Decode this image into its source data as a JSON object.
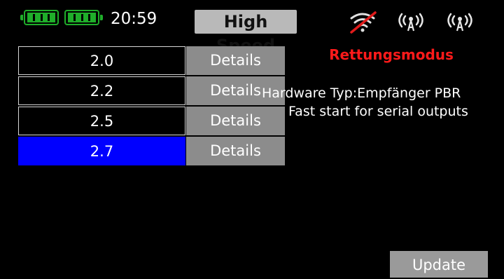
{
  "status": {
    "time": "20:59",
    "mode": "High Speed",
    "colors": {
      "battery": "#1fae2a",
      "signal_off": "#e01b1b"
    }
  },
  "icons": [
    "battery-icon",
    "battery-icon",
    "no-signal-icon",
    "antenna-icon",
    "antenna-icon"
  ],
  "versions": [
    {
      "label": "2.0",
      "button": "Details",
      "selected": false
    },
    {
      "label": "2.2",
      "button": "Details",
      "selected": false
    },
    {
      "label": "2.5",
      "button": "Details",
      "selected": false
    },
    {
      "label": "2.7",
      "button": "Details",
      "selected": true
    }
  ],
  "info": {
    "rescue_mode": "Rettungsmodus",
    "hardware": "Hardware Typ:Empfänger PBR",
    "fast_start": "Fast start for serial outputs"
  },
  "actions": {
    "update": "Update"
  }
}
